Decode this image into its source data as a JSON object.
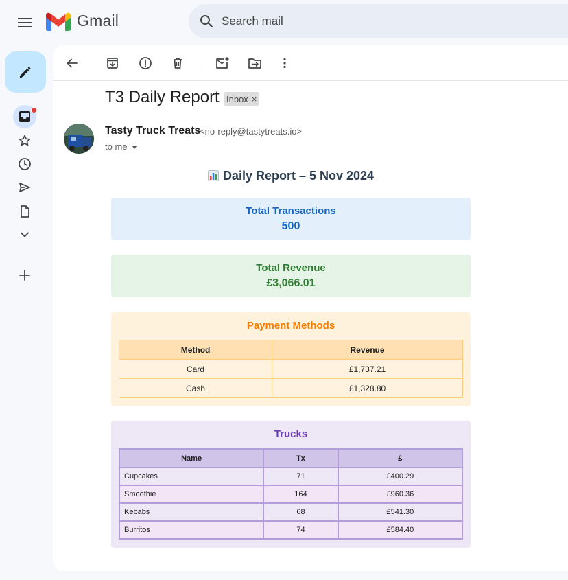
{
  "app": {
    "name": "Gmail"
  },
  "search": {
    "placeholder": "Search mail"
  },
  "email": {
    "subject": "T3 Daily Report",
    "label": "Inbox",
    "sender_name": "Tasty Truck Treats",
    "sender_email": "<no-reply@tastytreats.io>",
    "recipient": "to me"
  },
  "report": {
    "title": "Daily Report – 5 Nov 2024",
    "total_transactions": {
      "label": "Total Transactions",
      "value": "500"
    },
    "total_revenue": {
      "label": "Total Revenue",
      "value": "£3,066.01"
    },
    "payment_methods": {
      "title": "Payment Methods",
      "headers": [
        "Method",
        "Revenue"
      ],
      "rows": [
        [
          "Card",
          "£1,737.21"
        ],
        [
          "Cash",
          "£1,328.80"
        ]
      ]
    },
    "trucks": {
      "title": "Trucks",
      "headers": [
        "Name",
        "Tx",
        "£"
      ],
      "rows": [
        [
          "Cupcakes",
          "71",
          "£400.29"
        ],
        [
          "Smoothie",
          "164",
          "£960.36"
        ],
        [
          "Kebabs",
          "68",
          "£541.30"
        ],
        [
          "Burritos",
          "74",
          "£584.40"
        ]
      ]
    }
  },
  "colors": {
    "compose_bg": "#c2e7ff",
    "tx_accent": "#1565c0",
    "revenue_accent": "#2e7d32",
    "payment_accent": "#f57c00",
    "trucks_accent": "#6a3fb5"
  }
}
